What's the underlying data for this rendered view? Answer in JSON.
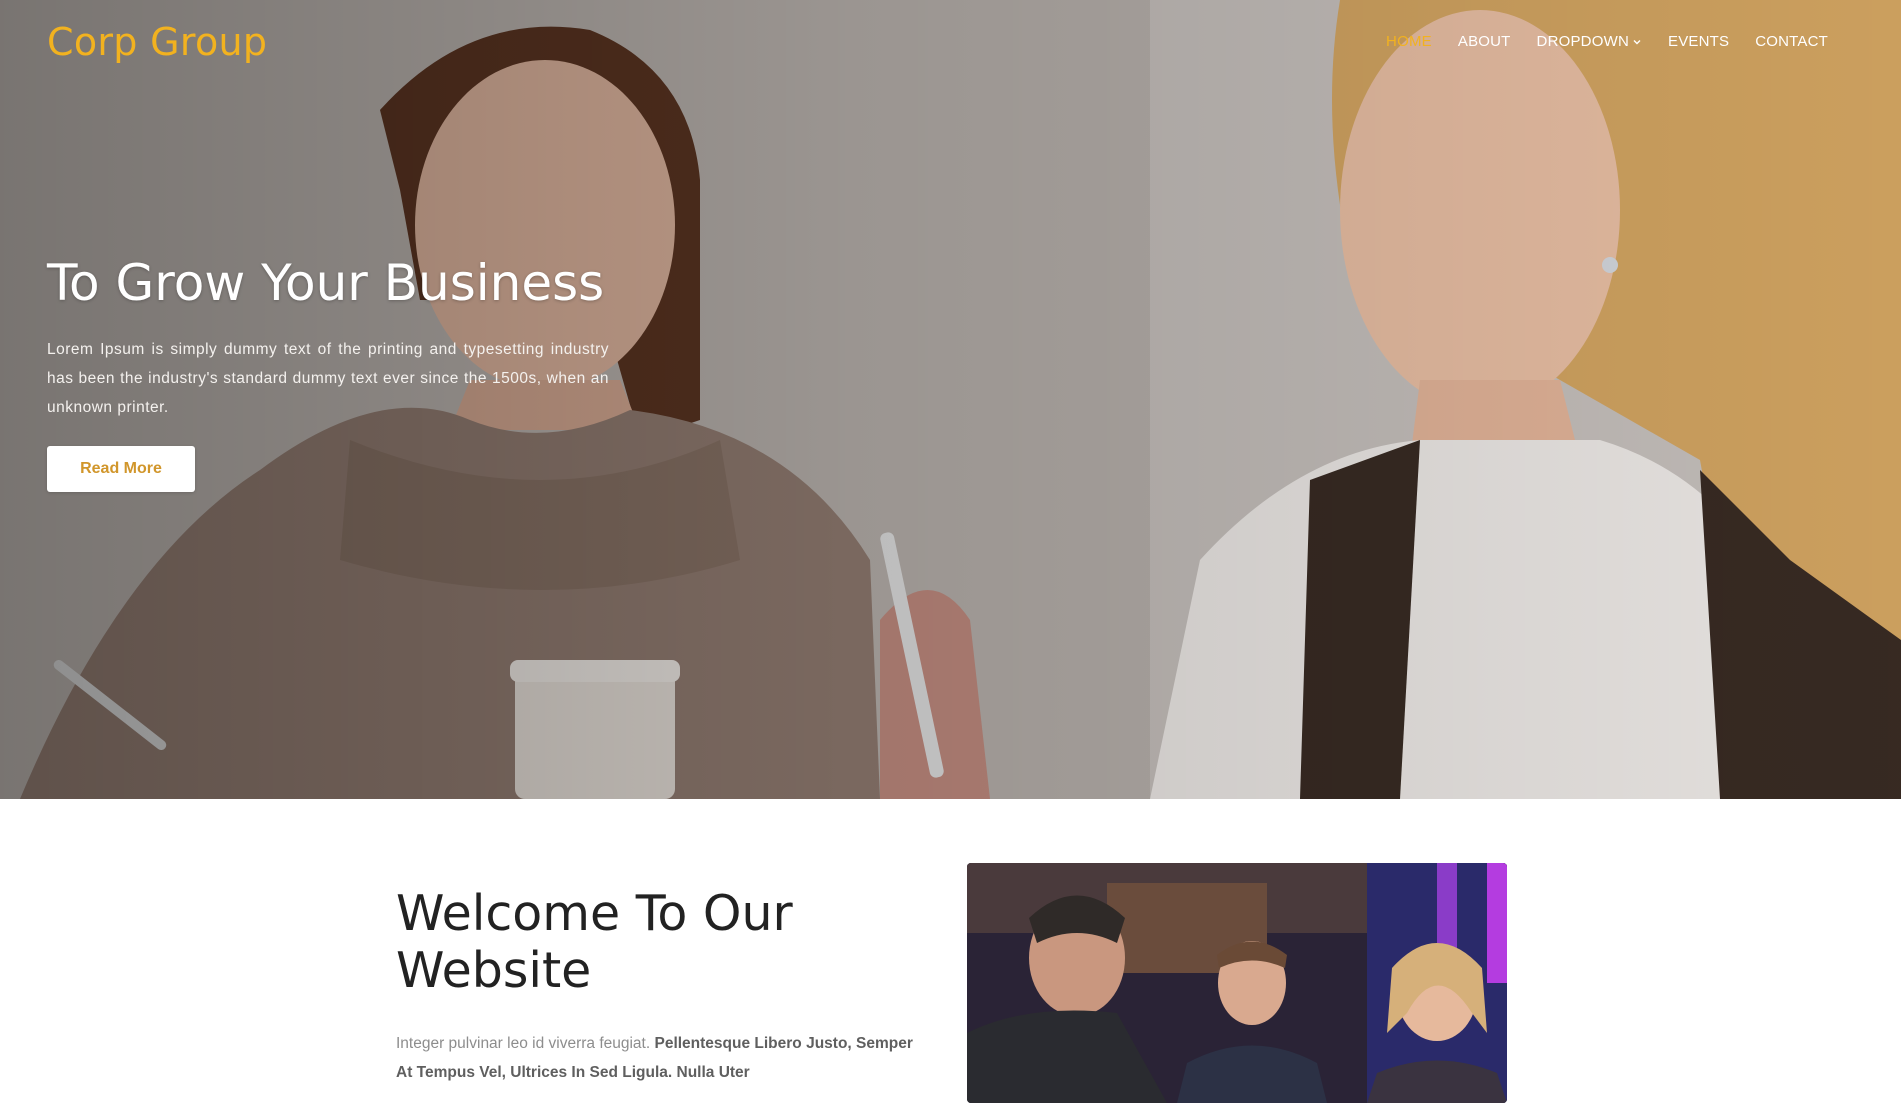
{
  "brand": {
    "name": "Corp Group"
  },
  "nav": {
    "items": [
      {
        "label": "HOME",
        "active": true
      },
      {
        "label": "ABOUT",
        "active": false
      },
      {
        "label": "DROPDOWN",
        "active": false
      },
      {
        "label": "EVENTS",
        "active": false
      },
      {
        "label": "CONTACT",
        "active": false
      }
    ],
    "dropdown_icon": "chevron-down-icon"
  },
  "hero": {
    "title": "To Grow Your Business",
    "text": "Lorem Ipsum is simply dummy text of the printing and typesetting industry has been the industry's standard dummy text ever since the 1500s, when an unknown printer.",
    "button_label": "Read More",
    "image": "two-women-talking-over-coffee"
  },
  "welcome": {
    "title_line1": "Welcome To Our",
    "title_line2": "Website",
    "text_plain": "Integer pulvinar leo id viverra feugiat. ",
    "text_bold": "Pellentesque Libero Justo, Semper At Tempus Vel, Ultrices In Sed Ligula. Nulla Uter",
    "image": "business-meeting-photo"
  },
  "colors": {
    "accent": "#f2b21f",
    "button_text": "#d1962b",
    "heading": "#222222",
    "body_text": "#8d8d8d"
  }
}
